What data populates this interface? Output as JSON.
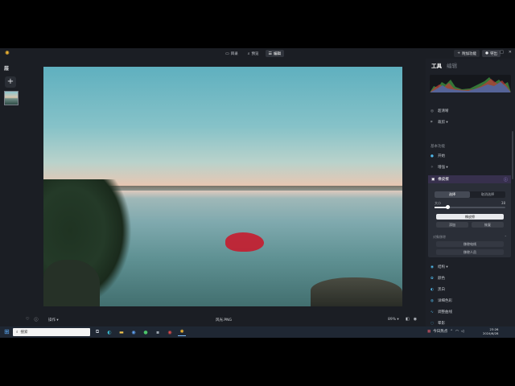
{
  "app": {
    "tabs": [
      {
        "label": "目录",
        "icon": "folder-icon"
      },
      {
        "label": "预览",
        "icon": "search-icon"
      },
      {
        "label": "编辑",
        "icon": "sliders-icon",
        "active": true
      }
    ],
    "right_buttons": {
      "add_label": "附加功能",
      "export_label": "导出"
    },
    "window_controls": [
      "—",
      "□",
      "✕"
    ]
  },
  "left": {
    "layers_title": "层",
    "add_symbol": "+"
  },
  "bottom": {
    "action_label": "操作 ▾",
    "file_name": "风光.PNG",
    "zoom": "89% ▾"
  },
  "panel": {
    "tab_tools": "工具",
    "tab_edit": "编辑",
    "rows_top": [
      {
        "label": "超清晰",
        "icon": "layers-icon"
      },
      {
        "label": "裁剪 ▾",
        "icon": "crop-icon"
      }
    ],
    "section_basic": "基本功能",
    "rows_basic": [
      {
        "label": "开始",
        "icon": "dot-icon"
      },
      {
        "label": "增强 ▾",
        "icon": "sparkle-icon"
      }
    ],
    "active_tool": {
      "title": "橡皮擦",
      "segments": [
        "选择",
        "取消选择"
      ],
      "size_label": "大小",
      "size_value": "38",
      "size_fraction": 0.18,
      "erase_button": "橡皮擦",
      "secondary_buttons": [
        "添加",
        "恢复"
      ],
      "object_section": "对象移除",
      "object_buttons": [
        "移除电线",
        "移除人员"
      ]
    },
    "rows_bottom": [
      {
        "label": "结构 ▾",
        "icon": "structure-icon"
      },
      {
        "label": "颜色",
        "icon": "color-icon"
      },
      {
        "label": "黑白",
        "icon": "bw-icon"
      },
      {
        "label": "详细色彩",
        "icon": "palette-icon"
      },
      {
        "label": "调整曲线",
        "icon": "curve-icon"
      },
      {
        "label": "晕影",
        "icon": "vignette-icon"
      }
    ]
  },
  "taskbar": {
    "search_placeholder": "搜索",
    "tray_label": "今日热点",
    "time": "23:26",
    "date": "2024/6/28"
  }
}
